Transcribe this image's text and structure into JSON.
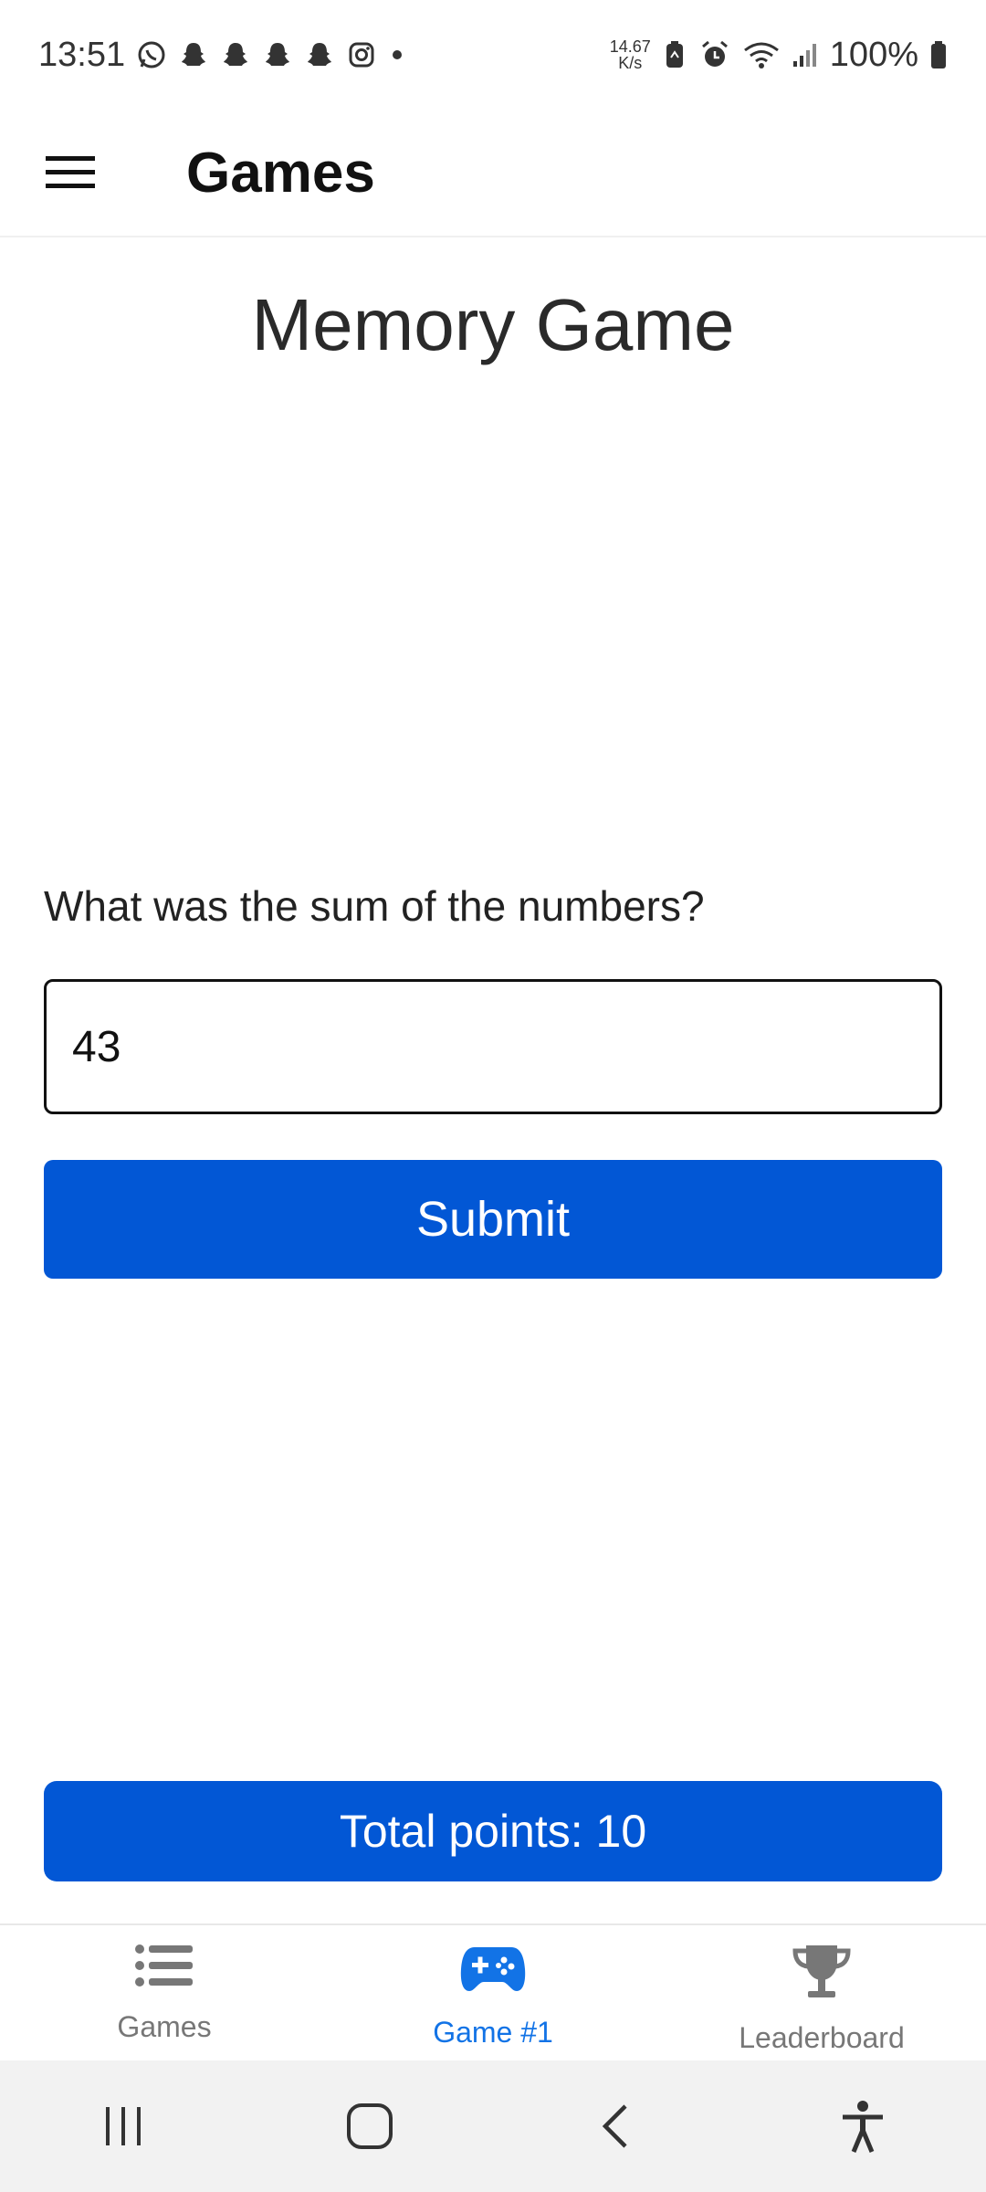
{
  "status_bar": {
    "time": "13:51",
    "net_speed_value": "14.67",
    "net_speed_unit": "K/s",
    "battery": "100%",
    "notification_icons": [
      "whatsapp-icon",
      "snapchat-icon",
      "snapchat-icon",
      "snapchat-icon",
      "snapchat-icon",
      "instagram-icon",
      "dot-icon"
    ],
    "system_icons": [
      "battery-saver-icon",
      "alarm-icon",
      "wifi-icon",
      "signal-icon",
      "battery-icon"
    ]
  },
  "app_bar": {
    "title": "Games",
    "menu_icon": "hamburger-menu-icon"
  },
  "main": {
    "title": "Memory Game",
    "question": "What was the sum of the numbers?",
    "answer_value": "43",
    "submit_label": "Submit",
    "total_points": "Total points: 10"
  },
  "bottom_nav": {
    "items": [
      {
        "label": "Games",
        "icon": "list-icon",
        "active": false
      },
      {
        "label": "Game #1",
        "icon": "gamepad-icon",
        "active": true
      },
      {
        "label": "Leaderboard",
        "icon": "trophy-icon",
        "active": false
      }
    ]
  },
  "system_nav": [
    "recents-icon",
    "home-icon",
    "back-icon",
    "accessibility-icon"
  ],
  "colors": {
    "primary": "#0257d5",
    "active_tab": "#1273e6",
    "inactive_tab": "#777777"
  }
}
